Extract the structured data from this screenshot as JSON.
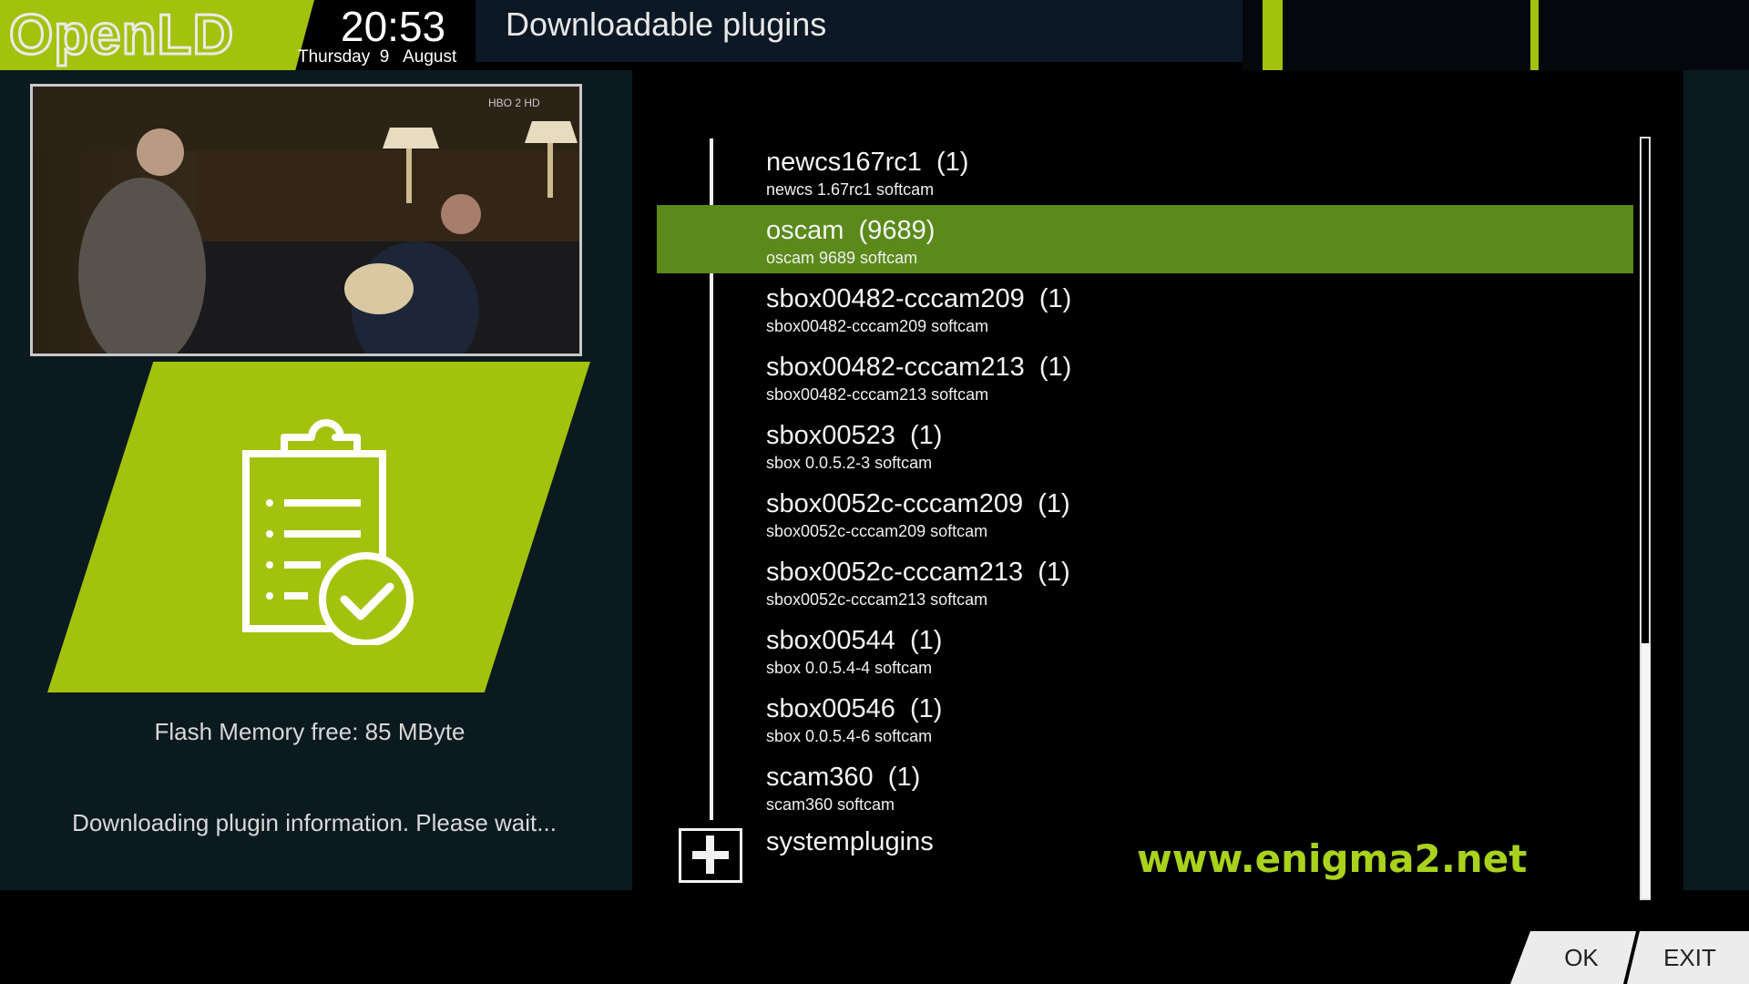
{
  "header": {
    "logo": "OpenLD",
    "time": "20:53",
    "date": "Thursday  9   August",
    "title": "Downloadable plugins"
  },
  "colors": {
    "accent": "#a3c20e",
    "selection": "#5b8a1a",
    "panel": "#0b1a1f",
    "watermark": "#a9d21c"
  },
  "left_panel": {
    "icon": "clipboard-check-icon",
    "flash_memory": "Flash Memory free: 85 MByte",
    "status": "Downloading plugin information. Please wait..."
  },
  "list": {
    "selected_index": 1,
    "items": [
      {
        "title": "newcs167rc1  (1)",
        "subtitle": "newcs 1.67rc1 softcam"
      },
      {
        "title": "oscam  (9689)",
        "subtitle": "oscam 9689 softcam"
      },
      {
        "title": "sbox00482-cccam209  (1)",
        "subtitle": "sbox00482-cccam209 softcam"
      },
      {
        "title": "sbox00482-cccam213  (1)",
        "subtitle": "sbox00482-cccam213 softcam"
      },
      {
        "title": "sbox00523  (1)",
        "subtitle": "sbox 0.0.5.2-3 softcam"
      },
      {
        "title": "sbox0052c-cccam209  (1)",
        "subtitle": "sbox0052c-cccam209 softcam"
      },
      {
        "title": "sbox0052c-cccam213  (1)",
        "subtitle": "sbox0052c-cccam213 softcam"
      },
      {
        "title": "sbox00544  (1)",
        "subtitle": "sbox 0.0.5.4-4 softcam"
      },
      {
        "title": "sbox00546  (1)",
        "subtitle": "sbox 0.0.5.4-6 softcam"
      },
      {
        "title": "scam360  (1)",
        "subtitle": "scam360 softcam"
      }
    ],
    "expandable_item": {
      "title": "systemplugins",
      "icon": "plus-icon"
    }
  },
  "watermark": "www.enigma2.net",
  "buttons": {
    "ok": "OK",
    "exit": "EXIT"
  },
  "preview": {
    "channel_logo": "HBO 2 HD"
  }
}
